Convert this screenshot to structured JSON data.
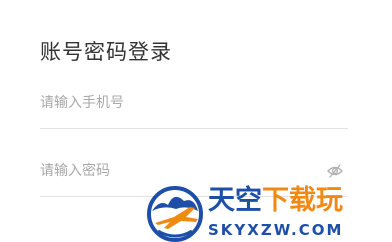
{
  "login": {
    "title": "账号密码登录",
    "phone": {
      "placeholder": "请输入手机号",
      "value": ""
    },
    "password": {
      "placeholder": "请输入密码",
      "value": ""
    },
    "toggle_visibility_icon": "eye-closed-icon"
  },
  "watermark": {
    "logo_icon": "airplane-globe-logo",
    "name_part1": "天空",
    "name_part2": "下载玩",
    "domain": "SKYXZW.COM",
    "colors": {
      "blue": "#1d4fa8",
      "orange": "#f08a14"
    }
  },
  "colors": {
    "title": "#333333",
    "placeholder": "#a8a8a8",
    "divider": "#e3e3e3",
    "icon": "#b0b0b0"
  }
}
